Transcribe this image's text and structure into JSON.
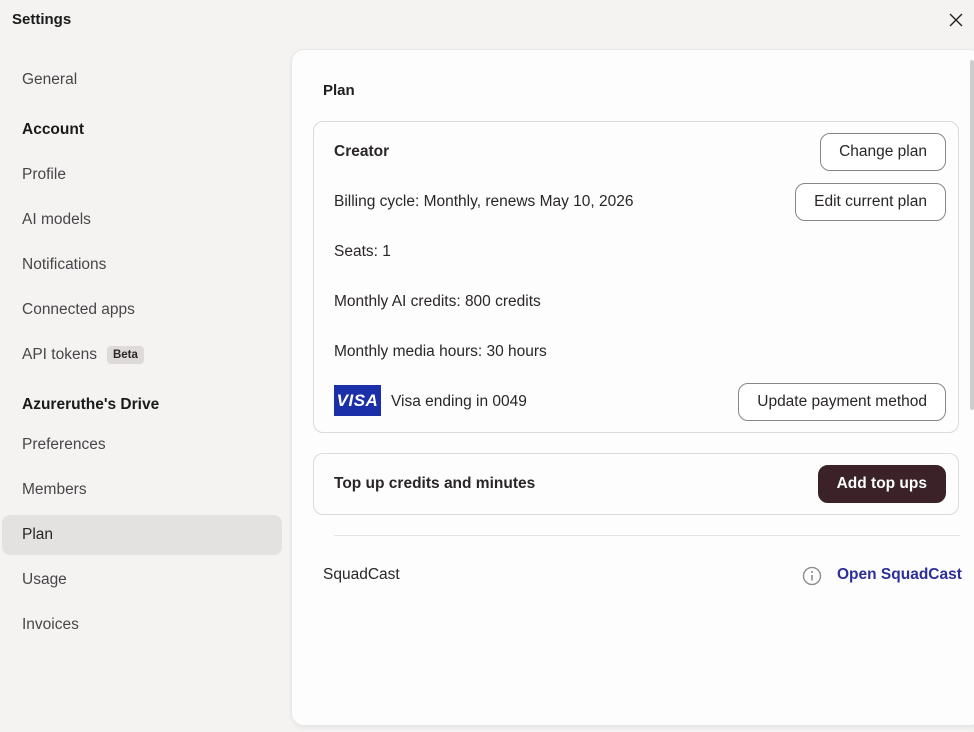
{
  "window": {
    "title": "Settings",
    "close_icon": "close-icon"
  },
  "sidebar": {
    "general": "General",
    "account_header": "Account",
    "profile": "Profile",
    "ai_models": "AI models",
    "notifications": "Notifications",
    "connected_apps": "Connected apps",
    "api_tokens": "API tokens",
    "api_tokens_badge": "Beta",
    "drive_header": "Azureruthe's Drive",
    "preferences": "Preferences",
    "members": "Members",
    "plan": "Plan",
    "usage": "Usage",
    "invoices": "Invoices",
    "active_item": "Plan"
  },
  "main": {
    "title": "Plan",
    "plan_card": {
      "plan_name": "Creator",
      "change_plan_label": "Change plan",
      "billing_cycle": "Billing cycle: Monthly, renews May 10, 2026",
      "edit_plan_label": "Edit current plan",
      "seats": "Seats: 1",
      "ai_credits": "Monthly AI credits: 800 credits",
      "media_hours": "Monthly media hours: 30 hours",
      "card_brand": "VISA",
      "card_text": "Visa ending in 0049",
      "update_payment_label": "Update payment method"
    },
    "topup_card": {
      "label": "Top up credits and minutes",
      "button_label": "Add top ups"
    },
    "squadcast": {
      "label": "SquadCast",
      "link_label": "Open SquadCast",
      "info_icon": "info-icon"
    }
  },
  "colors": {
    "background": "#f4f3f2",
    "panel": "#fdfdfd",
    "primary_button": "#3a2228",
    "link": "#2b2f9a",
    "visa": "#1a2fa8",
    "active_nav": "#e4e1e1"
  }
}
